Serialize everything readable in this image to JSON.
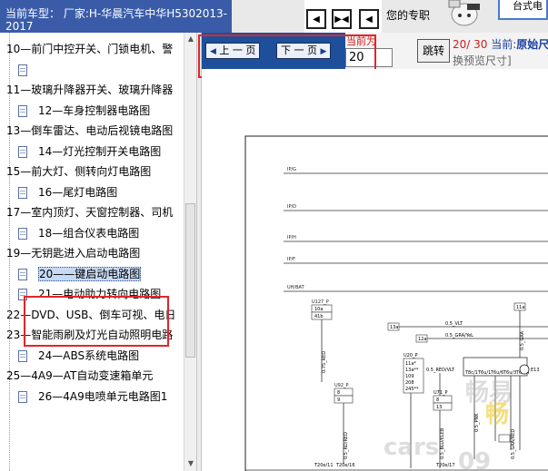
{
  "header": {
    "vehicle_line1": "当前车型：  厂家:H-华晨汽车中华H5302013-",
    "vehicle_line2": "2017",
    "nav_first": "◀",
    "nav_mid": "▶◀",
    "nav_last": "◀",
    "pro_text": "您的专职",
    "logo_text": "台式电"
  },
  "sidebar": {
    "items": [
      {
        "label": "10—前门中控开关、门锁电机、警",
        "type": "group"
      },
      {
        "label": "",
        "type": "doc"
      },
      {
        "label": "11—玻璃升降器开关、玻璃升降器",
        "type": "group"
      },
      {
        "label": "12—车身控制器电路图",
        "type": "doc"
      },
      {
        "label": "13—倒车雷达、电动后视镜电路图",
        "type": "group"
      },
      {
        "label": "14—灯光控制开关电路图",
        "type": "doc"
      },
      {
        "label": "15—前大灯、侧转向灯电路图",
        "type": "group"
      },
      {
        "label": "16—尾灯电路图",
        "type": "doc"
      },
      {
        "label": "17—室内顶灯、天窗控制器、司机",
        "type": "group"
      },
      {
        "label": "18—组合仪表电路图",
        "type": "doc"
      },
      {
        "label": "19—无钥匙进入启动电路图",
        "type": "group"
      },
      {
        "label": "20——键启动电路图",
        "type": "doc"
      },
      {
        "label": "21—电动助力转向电路图",
        "type": "doc"
      },
      {
        "label": "22—DVD、USB、倒车可视、电日",
        "type": "group"
      },
      {
        "label": "23—智能雨刷及灯光自动照明电路",
        "type": "group"
      },
      {
        "label": "24—ABS系统电路图",
        "type": "doc"
      },
      {
        "label": "25—4A9—AT自动变速箱单元",
        "type": "group"
      },
      {
        "label": "26—4A9电喷单元电路图1",
        "type": "doc"
      }
    ],
    "selected_index": 11
  },
  "toolbar": {
    "prev_label": "上 一 页",
    "next_label": "下 一 页",
    "current_page_label": "当前为",
    "page_input_value": "20",
    "jump_label": "跳转",
    "page_count": "20/ 30",
    "current_prefix": "当前:",
    "original_size": "原始尺",
    "preview_hint": "换预览尺寸]"
  },
  "diagram": {
    "rails": [
      "IP/G",
      "IP/D",
      "IP/H",
      "IP/F",
      "UH/BAT"
    ],
    "labels": {
      "u127": "U127_P",
      "u127_pins": [
        "10a",
        "41b"
      ],
      "w075": "0.75_RED",
      "u92": "U92_P",
      "u92_pins": [
        "8",
        "9"
      ],
      "w05r": "0.5_RD/RED",
      "c13a": "13a",
      "c12a": "12a",
      "c11a": "11a",
      "w05vlt": "0.5_VLT",
      "w05gra": "0.5_GRA/YeL",
      "u20": "U20_P",
      "u20_pins": [
        "11a*",
        "13a**",
        "109",
        "208",
        "245**"
      ],
      "w05redvlt": "0.5_RED/VLT",
      "w05gra2": "0.5_GRA",
      "u71": "U71_P",
      "u71_pins": [
        "8",
        "13"
      ],
      "w05pnk": "0.5_PNK",
      "w05blk": "0.5_BLU/ELEB",
      "w05gra3": "0.5_GRA/RED",
      "pins_row": [
        "T8c/1",
        "T6u/1",
        "T6u/6",
        "T6u/3",
        "T6u/4"
      ],
      "bottom_pins": [
        "T20e/11",
        "T20e/16",
        "T20e/17"
      ],
      "e13": "E13"
    }
  },
  "watermarks": [
    "畅易",
    "cars",
    "09",
    "畅"
  ]
}
